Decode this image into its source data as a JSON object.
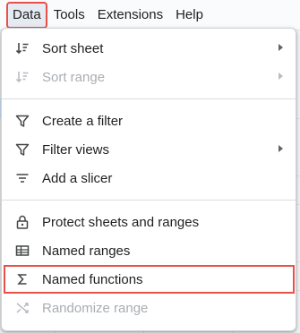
{
  "menubar": {
    "items": [
      {
        "label": "Data"
      },
      {
        "label": "Tools"
      },
      {
        "label": "Extensions"
      },
      {
        "label": "Help"
      }
    ]
  },
  "menu": {
    "items": [
      {
        "label": "Sort sheet",
        "icon": "sort-icon",
        "disabled": false,
        "submenu": true
      },
      {
        "label": "Sort range",
        "icon": "sort-icon",
        "disabled": true,
        "submenu": true
      },
      {
        "label": "Create a filter",
        "icon": "filter-icon",
        "disabled": false,
        "submenu": false
      },
      {
        "label": "Filter views",
        "icon": "filter-views-icon",
        "disabled": false,
        "submenu": true
      },
      {
        "label": "Add a slicer",
        "icon": "slicer-icon",
        "disabled": false,
        "submenu": false
      },
      {
        "label": "Protect sheets and ranges",
        "icon": "lock-icon",
        "disabled": false,
        "submenu": false
      },
      {
        "label": "Named ranges",
        "icon": "table-icon",
        "disabled": false,
        "submenu": false
      },
      {
        "label": "Named functions",
        "icon": "sigma-icon",
        "disabled": false,
        "submenu": false,
        "highlighted": true
      },
      {
        "label": "Randomize range",
        "icon": "shuffle-icon",
        "disabled": true,
        "submenu": false
      }
    ]
  },
  "colors": {
    "highlight_outline": "#e8504a",
    "disabled_text": "#a9adb2"
  }
}
